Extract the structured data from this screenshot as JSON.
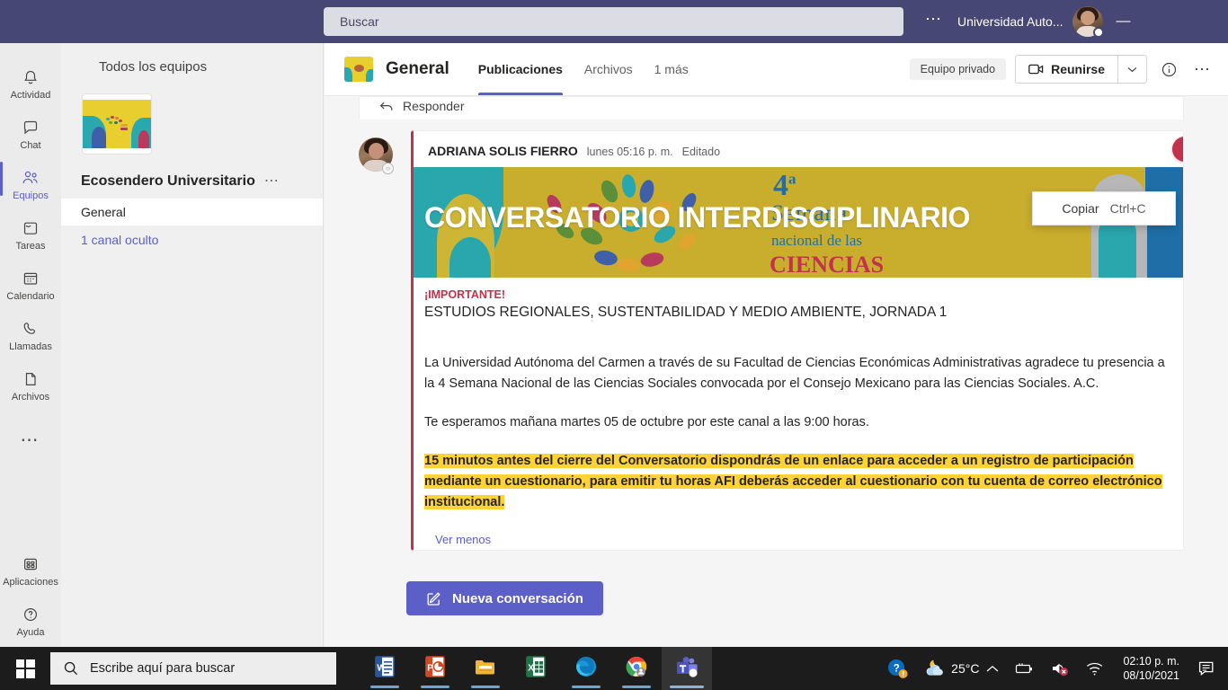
{
  "titlebar": {
    "search_placeholder": "Buscar",
    "more_icon": "ellipsis-icon",
    "org_name": "Universidad Auto...",
    "avatar_name": "user-avatar",
    "minimize_label": "—"
  },
  "rail": {
    "items": [
      {
        "label": "Actividad",
        "icon": "bell-icon",
        "active": false
      },
      {
        "label": "Chat",
        "icon": "chat-icon",
        "active": false
      },
      {
        "label": "Equipos",
        "icon": "teams-icon",
        "active": true
      },
      {
        "label": "Tareas",
        "icon": "tasks-icon",
        "active": false
      },
      {
        "label": "Calendario",
        "icon": "calendar-icon",
        "active": false
      },
      {
        "label": "Llamadas",
        "icon": "phone-icon",
        "active": false
      },
      {
        "label": "Archivos",
        "icon": "file-icon",
        "active": false
      },
      {
        "label": "",
        "icon": "ellipsis-icon",
        "active": false
      }
    ],
    "bottom": [
      {
        "label": "Aplicaciones",
        "icon": "apps-grid-icon"
      },
      {
        "label": "Ayuda",
        "icon": "help-circle-icon"
      }
    ]
  },
  "teams_panel": {
    "title": "Todos los equipos",
    "team_name": "Ecosendero Universitario",
    "team_more_icon": "ellipsis-icon",
    "channels": [
      {
        "name": "General",
        "selected": true
      }
    ],
    "hidden_channels": "1 canal oculto"
  },
  "channel_header": {
    "channel_title": "General",
    "tabs": [
      {
        "label": "Publicaciones",
        "active": true
      },
      {
        "label": "Archivos",
        "active": false
      },
      {
        "label": "1 más",
        "active": false
      }
    ],
    "privacy_badge": "Equipo privado",
    "meet_button": "Reunirse",
    "meet_caret_icon": "chevron-down-icon",
    "info_icon": "info-circle-icon",
    "more_icon": "ellipsis-icon"
  },
  "conversation": {
    "reply_label": "Responder",
    "reply_icon": "reply-arrow-icon",
    "message": {
      "author": "ADRIANA SOLIS FIERRO",
      "timestamp": "lunes 05:16 p. m.",
      "edited_label": "Editado",
      "urgent_icon": "important-exclamation-icon",
      "banner": {
        "overlay_title": "CONVERSATORIO INTERDISCIPLINARIO",
        "edition": "4",
        "edition_sup": "a",
        "line1": "Semana",
        "line2": "nacional de las",
        "line3": "CIENCIAS"
      },
      "important_label": "¡IMPORTANTE!",
      "subject": "ESTUDIOS REGIONALES, SUSTENTABILIDAD Y MEDIO AMBIENTE, JORNADA 1",
      "paragraphs": [
        "La Universidad Autónoma del Carmen a través de su Facultad de Ciencias Económicas Administrativas agradece tu presencia a la 4 Semana Nacional de las Ciencias Sociales convocada por el Consejo Mexicano para las Ciencias Sociales. A.C.",
        "Te esperamos mañana martes 05 de octubre por este canal a las 9:00 horas."
      ],
      "highlighted_paragraph": "15 minutos antes del cierre del Conversatorio dispondrás de un enlace para acceder a un registro de participación mediante un cuestionario, para emitir tu horas AFI deberás acceder al cuestionario con tu cuenta de correo electrónico institucional.",
      "see_less": "Ver menos"
    },
    "context_menu": {
      "label": "Copiar",
      "shortcut": "Ctrl+C"
    },
    "new_conversation_button": "Nueva conversación",
    "new_conversation_icon": "compose-icon"
  },
  "taskbar": {
    "start_icon": "windows-logo-icon",
    "search_placeholder": "Escribe aquí para buscar",
    "search_icon": "search-icon",
    "apps": [
      {
        "name": "word-icon",
        "running": true,
        "active": false
      },
      {
        "name": "powerpoint-icon",
        "running": true,
        "active": false
      },
      {
        "name": "file-explorer-icon",
        "running": true,
        "active": false
      },
      {
        "name": "excel-icon",
        "running": false,
        "active": false
      },
      {
        "name": "edge-icon",
        "running": true,
        "active": false
      },
      {
        "name": "chrome-icon",
        "running": true,
        "active": false
      },
      {
        "name": "teams-icon",
        "running": true,
        "active": true
      }
    ],
    "tray": {
      "help_icon": "help-badge-icon",
      "weather_icon": "night-cloud-icon",
      "temperature": "25°C",
      "chevron_icon": "chevron-up-icon",
      "battery_icon": "battery-charging-icon",
      "volume_icon": "speaker-muted-icon",
      "network_icon": "wifi-icon",
      "time": "02:10 p. m.",
      "date": "08/10/2021",
      "notifications_icon": "notification-icon"
    }
  },
  "colors": {
    "teams_purple": "#464775",
    "accent": "#5b5fc7",
    "urgent_red": "#c4314b",
    "highlight_yellow": "#ffd236",
    "banner_gold": "#cdb535"
  }
}
